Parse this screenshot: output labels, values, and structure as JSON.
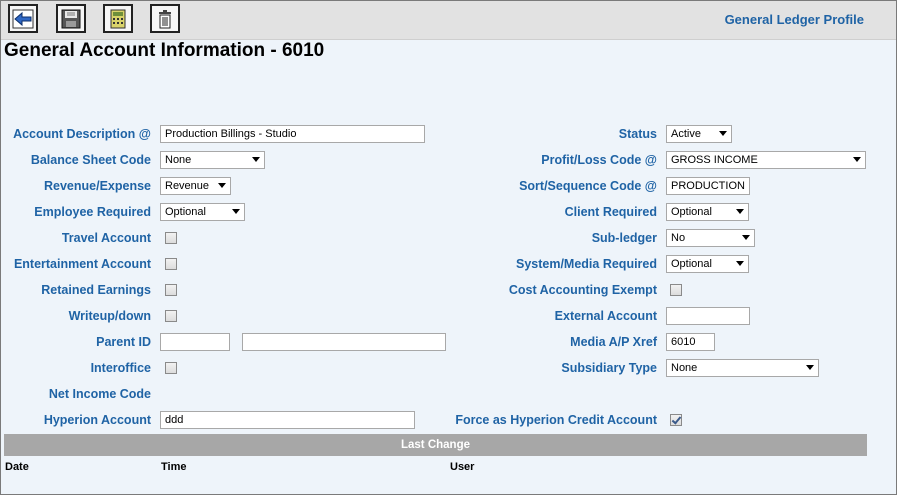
{
  "toolbar": {
    "buttons": [
      {
        "name": "back-button",
        "icon": "arrow-left-icon"
      },
      {
        "name": "save-button",
        "icon": "save-icon"
      },
      {
        "name": "calculator-button",
        "icon": "calculator-icon"
      },
      {
        "name": "delete-button",
        "icon": "trash-icon"
      }
    ],
    "profile_title": "General Ledger Profile"
  },
  "page_title": "General Account Information - 6010",
  "form": {
    "account_description": {
      "label": "Account Description",
      "required_marker": "@",
      "value": "Production Billings - Studio"
    },
    "balance_sheet_code": {
      "label": "Balance Sheet Code",
      "value": "None"
    },
    "revenue_expense": {
      "label": "Revenue/Expense",
      "value": "Revenue"
    },
    "employee_required": {
      "label": "Employee Required",
      "value": "Optional"
    },
    "travel_account": {
      "label": "Travel Account",
      "checked": false
    },
    "entertainment_account": {
      "label": "Entertainment Account",
      "checked": false
    },
    "retained_earnings": {
      "label": "Retained Earnings",
      "checked": false
    },
    "writeup_down": {
      "label": "Writeup/down",
      "checked": false
    },
    "parent_id": {
      "label": "Parent ID",
      "value": "",
      "description": ""
    },
    "interoffice": {
      "label": "Interoffice",
      "checked": false
    },
    "net_income_code": {
      "label": "Net Income Code"
    },
    "hyperion_account": {
      "label": "Hyperion Account",
      "value": "ddd"
    },
    "status": {
      "label": "Status",
      "value": "Active"
    },
    "profit_loss_code": {
      "label": "Profit/Loss Code",
      "required_marker": "@",
      "value": "GROSS INCOME"
    },
    "sort_sequence_code": {
      "label": "Sort/Sequence Code",
      "required_marker": "@",
      "value": "PRODUCTION"
    },
    "client_required": {
      "label": "Client Required",
      "value": "Optional"
    },
    "sub_ledger": {
      "label": "Sub-ledger",
      "value": "No"
    },
    "system_media_required": {
      "label": "System/Media Required",
      "value": "Optional"
    },
    "cost_accounting_exempt": {
      "label": "Cost Accounting Exempt",
      "checked": false
    },
    "external_account": {
      "label": "External Account",
      "value": ""
    },
    "media_ap_xref": {
      "label": "Media A/P Xref",
      "value": "6010"
    },
    "subsidiary_type": {
      "label": "Subsidiary Type",
      "value": "None"
    },
    "force_hyperion_credit": {
      "label": "Force as Hyperion Credit Account",
      "checked": true
    }
  },
  "last_change": {
    "title": "Last Change",
    "columns": [
      "Date",
      "Time",
      "User"
    ]
  },
  "colors": {
    "label": "#1f63a5",
    "background": "#eef4fa",
    "band": "#a7a7a7"
  }
}
